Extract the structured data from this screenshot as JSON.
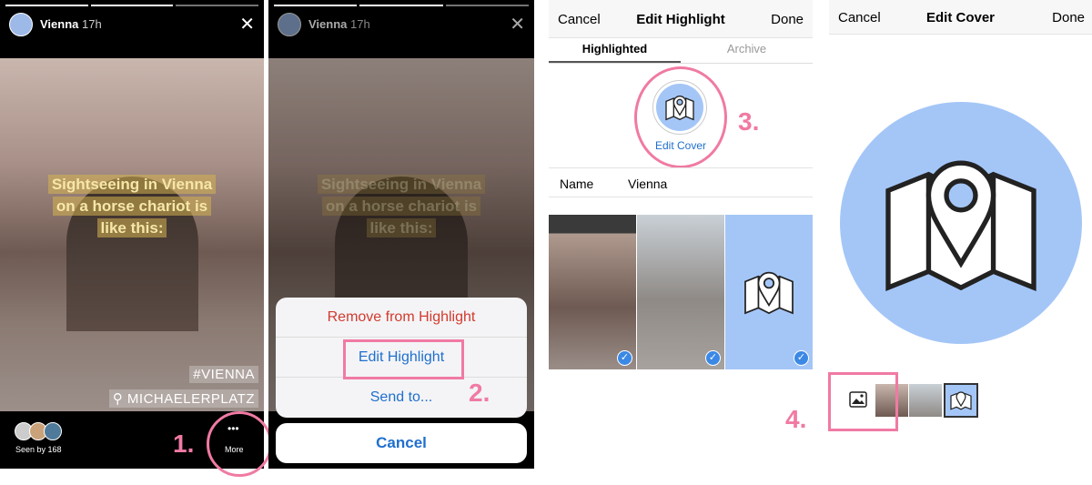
{
  "story": {
    "user": "Vienna",
    "time": "17h",
    "caption": [
      "Sightseeing in Vienna",
      "on a horse chariot is",
      "like this:"
    ],
    "tags": [
      "#VIENNA",
      "MICHAELERPLATZ"
    ],
    "seen_by": "Seen by 168",
    "more_label": "More",
    "more_icon": "ellipsis-icon"
  },
  "action_sheet": {
    "items": [
      "Remove from Highlight",
      "Edit Highlight",
      "Send to..."
    ],
    "cancel": "Cancel"
  },
  "edit_highlight": {
    "cancel": "Cancel",
    "title": "Edit Highlight",
    "done": "Done",
    "tabs": [
      "Highlighted",
      "Archive"
    ],
    "active_tab": "Highlighted",
    "edit_cover": "Edit Cover",
    "name_label": "Name",
    "name_value": "Vienna"
  },
  "edit_cover": {
    "cancel": "Cancel",
    "title": "Edit Cover",
    "done": "Done",
    "gallery_icon": "image-icon"
  },
  "steps": [
    "1.",
    "2.",
    "3.",
    "4."
  ],
  "colors": {
    "annotation": "#f07aa3",
    "cover_blue": "#a4c6f7",
    "link_blue": "#1f6fcf",
    "remove_red": "#d23a2e"
  }
}
